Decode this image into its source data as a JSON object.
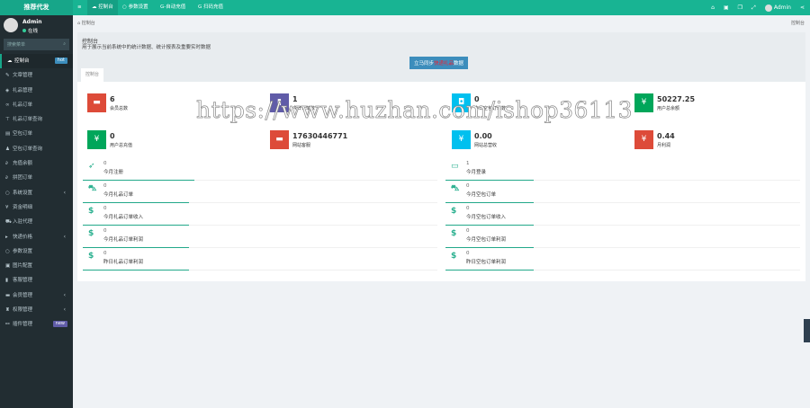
{
  "brand": "推荐代发",
  "user": {
    "name": "Admin",
    "status": "在线"
  },
  "search": {
    "placeholder": "搜索菜单"
  },
  "menu": [
    {
      "label": "控制台",
      "icon": "dashboard-icon",
      "badge": "hot",
      "badge_color": "#3c8dbc"
    },
    {
      "label": "文章管理",
      "icon": "pencil-icon"
    },
    {
      "label": "礼品管理",
      "icon": "cube-icon"
    },
    {
      "label": "礼品订单",
      "icon": "binoculars-icon"
    },
    {
      "label": "礼品订单查询",
      "icon": "filter-icon"
    },
    {
      "label": "空包订单",
      "icon": "list-icon"
    },
    {
      "label": "空包订单查询",
      "icon": "user-icon"
    },
    {
      "label": "充值余额",
      "icon": "link-icon"
    },
    {
      "label": "拼团订单",
      "icon": "link-icon"
    },
    {
      "label": "系统设置",
      "icon": "circle-icon",
      "arrow": true
    },
    {
      "label": "资金明细",
      "icon": "yen-icon"
    },
    {
      "label": "入驻代理",
      "icon": "car-icon"
    },
    {
      "label": "快递价格",
      "icon": "truck-icon",
      "arrow": true
    },
    {
      "label": "参数设置",
      "icon": "circle-icon"
    },
    {
      "label": "图片配置",
      "icon": "image-icon"
    },
    {
      "label": "客服管理",
      "icon": "book-icon"
    },
    {
      "label": "会员管理",
      "icon": "users-icon",
      "arrow": true
    },
    {
      "label": "权限管理",
      "icon": "group-icon",
      "arrow": true
    },
    {
      "label": "插件管理",
      "icon": "plug-icon",
      "badge": "new",
      "badge_color": "#605ca8"
    }
  ],
  "top_tabs": [
    "控制台",
    "参数设置",
    "G-自动充值",
    "G 扫码充值"
  ],
  "top_user": "Admin",
  "breadcrumb": "控制台",
  "breadcrumb_right": "控制台",
  "header": {
    "title": "控制台",
    "desc": "用于展示当前系统中的统计数据、统计报表及重要实时数据",
    "sync_pre": "立马同步",
    "sync_mid": "快递礼品",
    "sync_post": "数据",
    "tab": "控制台"
  },
  "stats": [
    {
      "value": "6",
      "label": "会员总数",
      "color": "#dd4b39",
      "icon": "users-icon"
    },
    {
      "value": "1",
      "label": "今日订单数",
      "color": "#605ca8",
      "icon": "book-icon"
    },
    {
      "value": "0",
      "label": "今日空包订单数",
      "color": "#00c0ef",
      "icon": "bag-icon"
    },
    {
      "value": "50227.25",
      "label": "用户总余额",
      "color": "#00a65a",
      "icon": "yen-icon"
    },
    {
      "value": "0",
      "label": "用户总充值",
      "color": "#00a65a",
      "icon": "yen-icon"
    },
    {
      "value": "17630446771",
      "label": "网站客服",
      "color": "#dd4b39",
      "icon": "users-icon"
    },
    {
      "value": "0.00",
      "label": "网站总营收",
      "color": "#00c0ef",
      "icon": "yen-icon"
    },
    {
      "value": "0.44",
      "label": "月利润",
      "color": "#dd4b39",
      "icon": "yen-icon"
    }
  ],
  "left_list": [
    {
      "value": "0",
      "label": "今月注册",
      "icon": "rocket-icon"
    },
    {
      "value": "0",
      "label": "今月礼品订单",
      "icon": "cart-icon"
    },
    {
      "value": "0",
      "label": "今月礼品订单收入",
      "icon": "dollar-icon"
    },
    {
      "value": "0",
      "label": "今月礼品订单利润",
      "icon": "dollar-icon"
    },
    {
      "value": "0",
      "label": "昨日礼品订单利润",
      "icon": "dollar-icon"
    }
  ],
  "right_list": [
    {
      "value": "1",
      "label": "今月登录",
      "icon": "card-icon"
    },
    {
      "value": "0",
      "label": "今月空包订单",
      "icon": "cart-icon"
    },
    {
      "value": "0",
      "label": "今月空包订单收入",
      "icon": "dollar-icon"
    },
    {
      "value": "0",
      "label": "今月空包订单利润",
      "icon": "dollar-icon"
    },
    {
      "value": "0",
      "label": "昨日空包订单利润",
      "icon": "dollar-icon"
    }
  ],
  "watermark": "https://www.huzhan.com/ishop36113"
}
